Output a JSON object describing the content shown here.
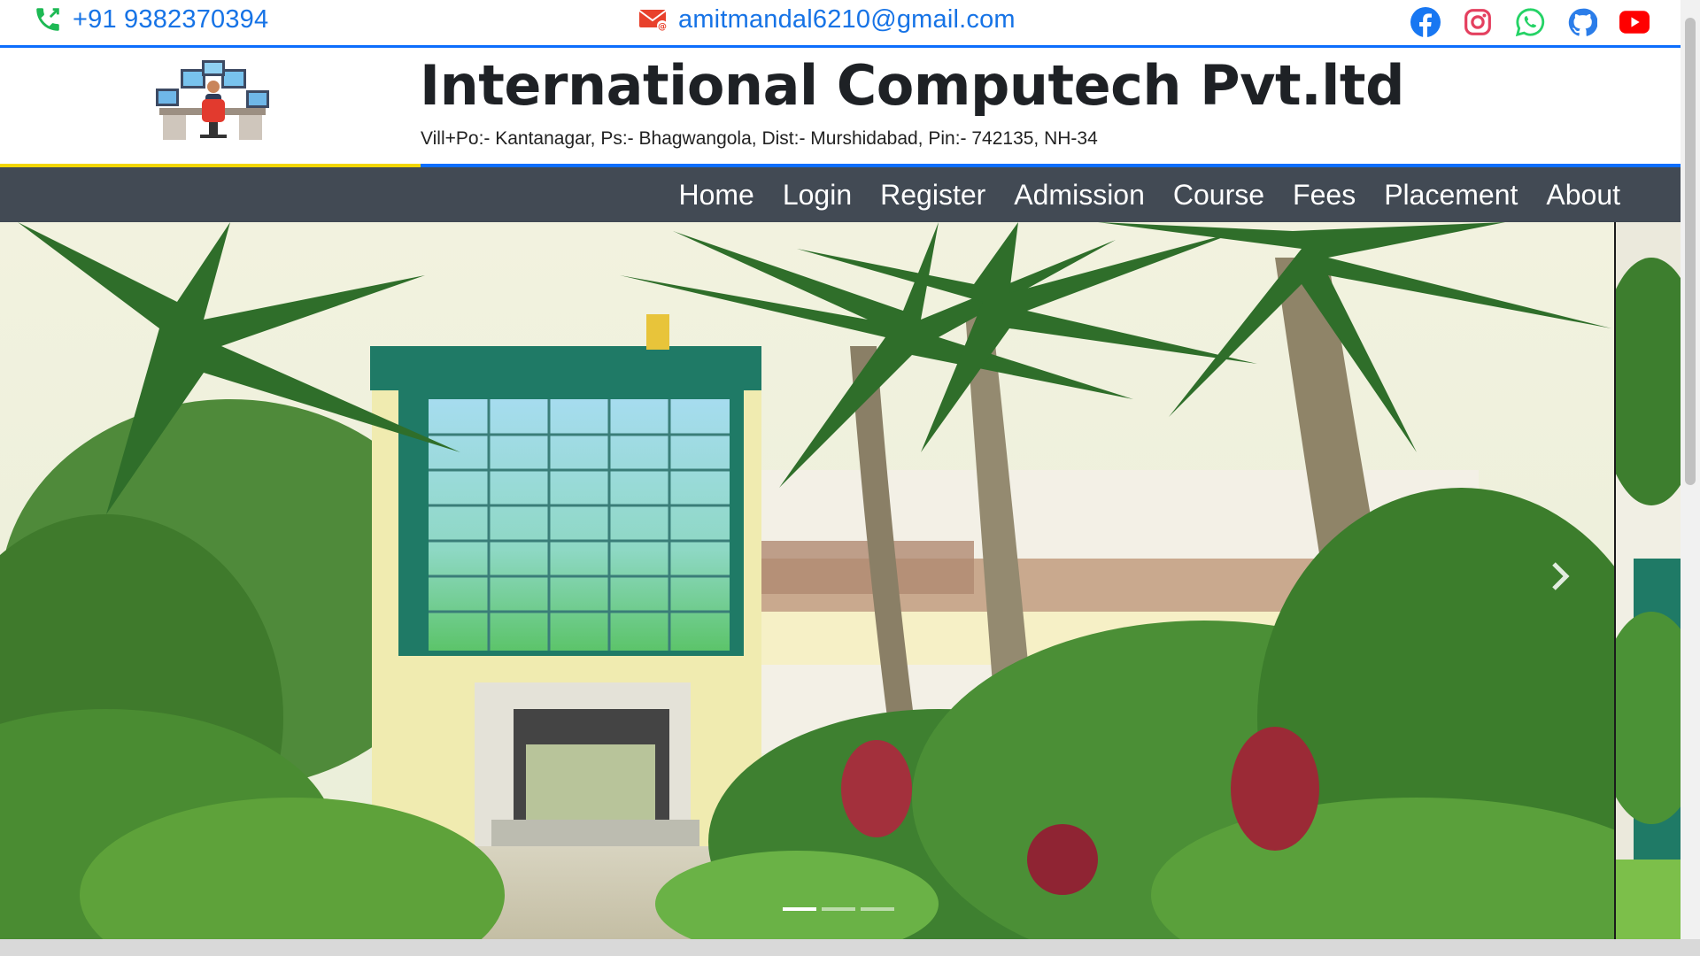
{
  "contact": {
    "phone": "+91 9382370394",
    "email": "amitmandal6210@gmail.com",
    "phone_icon": "phone-icon",
    "email_icon": "mail-icon"
  },
  "socials": [
    {
      "name": "facebook-icon",
      "color": "#1877f2"
    },
    {
      "name": "instagram-icon",
      "color": "#e4405f"
    },
    {
      "name": "whatsapp-icon",
      "color": "#25d366"
    },
    {
      "name": "github-icon",
      "color": "#2b7de9"
    },
    {
      "name": "youtube-icon",
      "color": "#ff0000"
    }
  ],
  "header": {
    "title": "International Computech Pvt.ltd",
    "address": "Vill+Po:- Kantanagar, Ps:- Bhagwangola, Dist:- Murshidabad, Pin:- 742135, NH-34"
  },
  "nav": {
    "items": [
      "Home",
      "Login",
      "Register",
      "Admission",
      "Course",
      "Fees",
      "Placement",
      "About"
    ]
  },
  "carousel": {
    "slides": 3,
    "active_slide": 1
  },
  "colors": {
    "accent_blue": "#0d6efd",
    "accent_yellow": "#f2d600",
    "navbar_bg": "#424a54",
    "link_blue": "#1673e6"
  }
}
